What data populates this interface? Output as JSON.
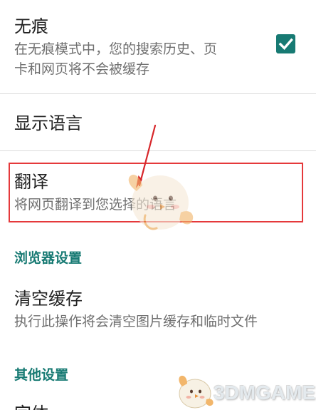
{
  "incognito": {
    "title": "无痕",
    "desc_line1": "在无痕模式中，您的搜索历史、页",
    "desc_line2": "卡和网页将不会被缓存",
    "checked": true
  },
  "display_language": {
    "title": "显示语言"
  },
  "translate": {
    "title": "翻译",
    "desc": "将网页翻译到您选择的语言"
  },
  "browser_settings": {
    "header": "浏览器设置"
  },
  "clear_cache": {
    "title": "清空缓存",
    "desc": "执行此操作将会清空图片缓存和临时文件"
  },
  "other_settings": {
    "header": "其他设置"
  },
  "next_item": {
    "title": "字体"
  },
  "watermark": {
    "logo_text": "3DMGAME"
  },
  "colors": {
    "accent": "#177a73",
    "highlight_border": "#e5393b",
    "text_primary": "#222222",
    "text_secondary": "#6f6f6f"
  },
  "icons": {
    "checkbox": "check-icon",
    "arrow": "red-arrow-annotation",
    "mascot": "mascot-watermark"
  }
}
